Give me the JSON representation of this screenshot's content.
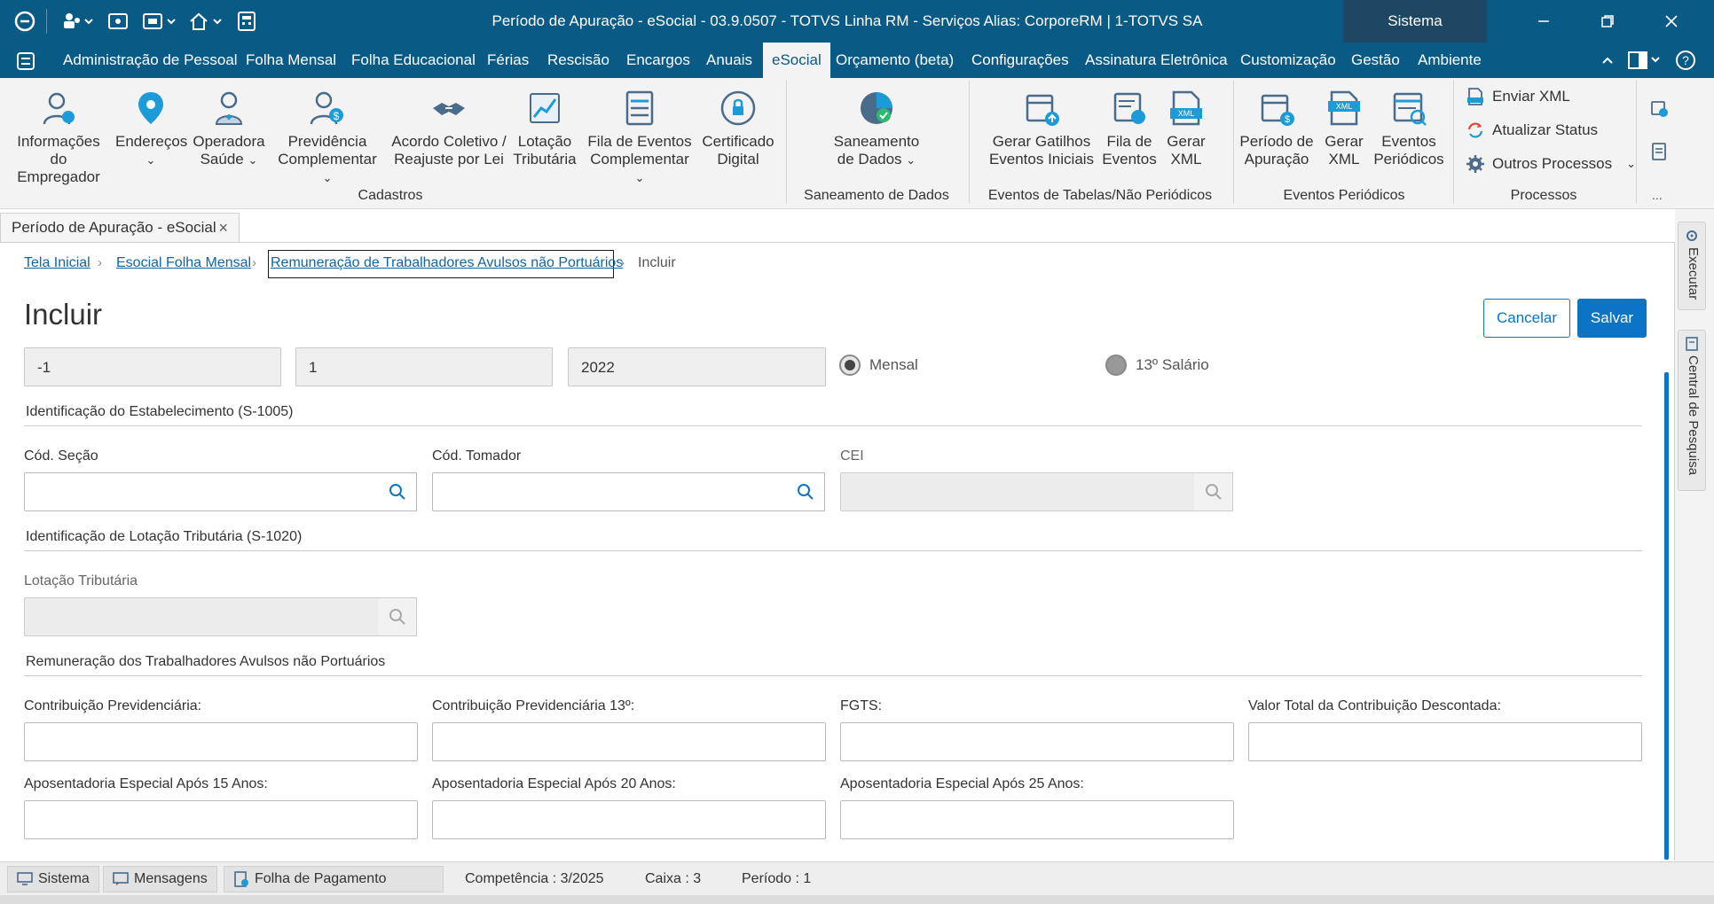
{
  "window": {
    "title": "Período de Apuração - eSocial - 03.9.0507 - TOTVS Linha RM - Serviços  Alias: CorporeRM | 1-TOTVS SA",
    "system_label": "Sistema"
  },
  "menu": {
    "items": [
      "Administração de Pessoal",
      "Folha Mensal",
      "Folha Educacional",
      "Férias",
      "Rescisão",
      "Encargos",
      "Anuais",
      "eSocial",
      "Orçamento (beta)",
      "Configurações",
      "Assinatura Eletrônica",
      "Customização",
      "Gestão",
      "Ambiente"
    ],
    "active": "eSocial"
  },
  "ribbon": {
    "cadastros": {
      "label": "Cadastros",
      "buttons": [
        {
          "l1": "Informações",
          "l2": "do Empregador",
          "icon": "employer-info-icon"
        },
        {
          "l1": "Endereços",
          "l2": "",
          "icon": "location-pin-icon"
        },
        {
          "l1": "Operadora",
          "l2": "Saúde",
          "icon": "health-operator-icon"
        },
        {
          "l1": "Previdência",
          "l2": "Complementar",
          "icon": "pension-icon"
        },
        {
          "l1": "Acordo Coletivo /",
          "l2": "Reajuste por Lei",
          "icon": "handshake-icon"
        },
        {
          "l1": "Lotação",
          "l2": "Tributária",
          "icon": "tax-chart-icon"
        },
        {
          "l1": "Fila de Eventos",
          "l2": "Complementar",
          "icon": "event-queue-icon"
        },
        {
          "l1": "Certificado",
          "l2": "Digital",
          "icon": "certificate-icon"
        }
      ]
    },
    "saneamento": {
      "label": "Saneamento de Dados",
      "button": {
        "l1": "Saneamento",
        "l2": "de Dados",
        "icon": "data-cleanup-icon"
      }
    },
    "eventos_tabelas": {
      "label": "Eventos de Tabelas/Não Periódicos",
      "buttons": [
        {
          "l1": "Gerar Gatilhos",
          "l2": "Eventos Iniciais",
          "icon": "calendar-trigger-icon"
        },
        {
          "l1": "Fila de",
          "l2": "Eventos",
          "icon": "event-list-icon"
        },
        {
          "l1": "Gerar",
          "l2": "XML",
          "icon": "xml-file-icon"
        }
      ]
    },
    "eventos_periodicos": {
      "label": "Eventos Periódicos",
      "buttons": [
        {
          "l1": "Período de",
          "l2": "Apuração",
          "icon": "calendar-money-icon"
        },
        {
          "l1": "Gerar",
          "l2": "XML",
          "icon": "xml-file-icon"
        },
        {
          "l1": "Eventos",
          "l2": "Periódicos",
          "icon": "periodic-events-icon"
        }
      ]
    },
    "processos": {
      "label": "Processos",
      "items": [
        {
          "label": "Enviar XML",
          "icon": "send-xml-icon"
        },
        {
          "label": "Atualizar Status",
          "icon": "refresh-icon"
        },
        {
          "label": "Outros Processos",
          "icon": "gear-icon"
        }
      ]
    },
    "more": "..."
  },
  "doc_tab": {
    "label": "Período de Apuração - eSocial",
    "close": "×"
  },
  "breadcrumb": {
    "items": [
      "Tela Inicial",
      "Esocial Folha Mensal",
      "Remuneração de Trabalhadores Avulsos não Portuários"
    ],
    "current": "Incluir",
    "sep": "›"
  },
  "page": {
    "title": "Incluir",
    "cancel": "Cancelar",
    "save": "Salvar"
  },
  "header_fields": {
    "f1": "-1",
    "f2": "1",
    "f3": "2022"
  },
  "radios": {
    "mensal": "Mensal",
    "decimo": "13º Salário",
    "selected": "Mensal"
  },
  "sections": {
    "estab": "Identificação do Estabelecimento (S-1005)",
    "lotacao": "Identificação de Lotação Tributária (S-1020)",
    "remuneracao": "Remuneração dos Trabalhadores Avulsos não Portuários"
  },
  "fields": {
    "cod_secao": "Cód. Seção",
    "cod_tomador": "Cód. Tomador",
    "cei": "CEI",
    "lotacao_tributaria": "Lotação Tributária",
    "contrib_prev": "Contribuição Previdenciária:",
    "contrib_prev_13": "Contribuição Previdenciária 13º:",
    "fgts": "FGTS:",
    "valor_total": "Valor Total da Contribuição Descontada:",
    "apos_15": "Aposentadoria Especial Após 15 Anos:",
    "apos_20": "Aposentadoria Especial Após 20 Anos:",
    "apos_25": "Aposentadoria Especial Após 25 Anos:"
  },
  "side_tabs": [
    "Executar",
    "Central de Pesquisa"
  ],
  "statusbar": {
    "sistema": "Sistema",
    "mensagens": "Mensagens",
    "folha": "Folha de Pagamento",
    "competencia": "Competência : 3/2025",
    "caixa": "Caixa : 3",
    "periodo": "Período : 1"
  },
  "colors": {
    "brand": "#0a5a86",
    "accent": "#0c74c4",
    "system_box": "#1d4763"
  }
}
